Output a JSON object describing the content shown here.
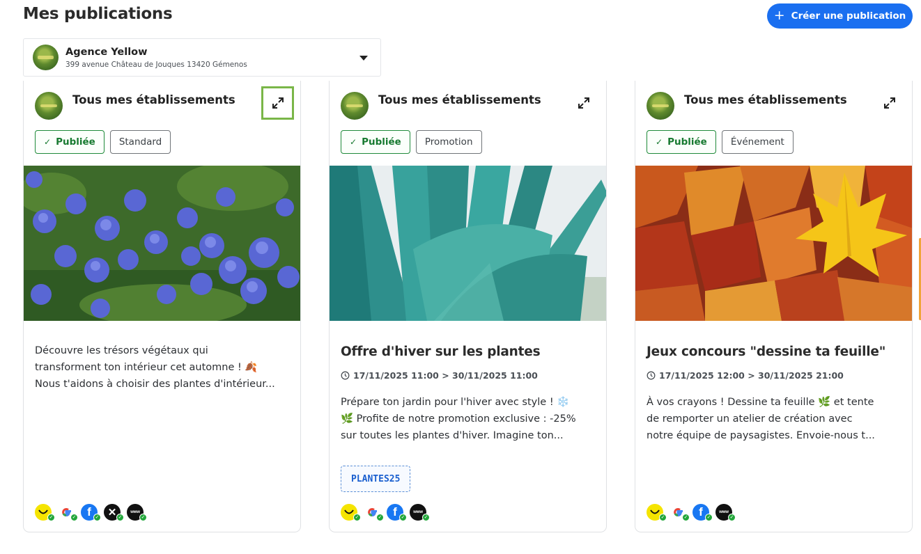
{
  "header": {
    "title": "Mes publications",
    "create_button": "Créer une publication"
  },
  "agency": {
    "name": "Agence Yellow",
    "address": "399 avenue Château de Jouques 13420 Gémenos"
  },
  "cards": [
    {
      "establishment": "Tous mes établissements",
      "status": "Publiée",
      "type": "Standard",
      "title": "",
      "dates": "",
      "body_lines": [
        "Découvre les trésors végétaux qui",
        "transforment ton intérieur cet automne ! 🍂",
        "Nous t'aidons à choisir des plantes d'intérieur..."
      ],
      "promo_code": "",
      "image": "blue-ceanothus-flowers"
    },
    {
      "establishment": "Tous mes établissements",
      "status": "Publiée",
      "type": "Promotion",
      "title": "Offre d'hiver sur les plantes",
      "dates": "17/11/2025 11:00 > 30/11/2025 11:00",
      "body_lines": [
        "Prépare ton jardin pour l'hiver avec style ! ❄️",
        "🌿 Profite de notre promotion exclusive : -25%",
        "sur toutes les plantes d'hiver. Imagine ton..."
      ],
      "promo_code": "PLANTES25",
      "image": "agave-leaves"
    },
    {
      "establishment": "Tous mes établissements",
      "status": "Publiée",
      "type": "Événement",
      "title": "Jeux concours \"dessine ta feuille\"",
      "dates": "17/11/2025 12:00 > 30/11/2025 21:00",
      "body_lines": [
        "À vos crayons ! Dessine ta feuille 🌿 et tente",
        "de remporter un atelier de création avec",
        "notre équipe de paysagistes. Envoie-nous t..."
      ],
      "promo_code": "",
      "image": "autumn-maple-leaves"
    }
  ],
  "network_icons": [
    "pagesjaunes-icon",
    "google-icon",
    "facebook-icon",
    "x-icon",
    "website-icon"
  ],
  "network_icons_labels": {
    "www": "www"
  },
  "colors": {
    "accent": "#1a6ff0",
    "published": "#1f8a3a",
    "focus": "#7ab648"
  }
}
